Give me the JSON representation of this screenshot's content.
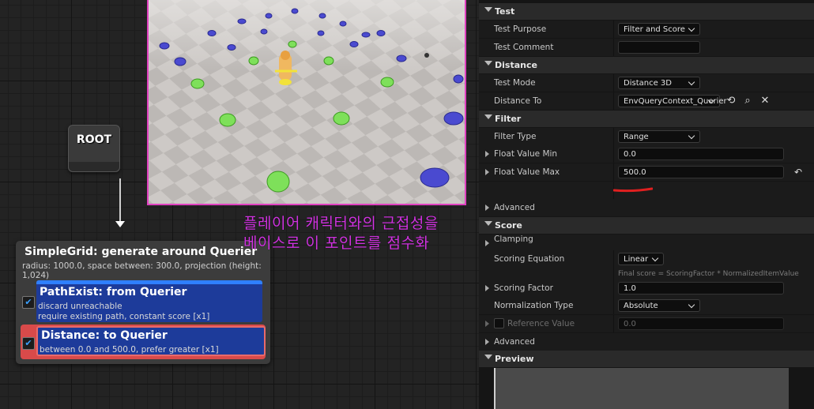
{
  "graph": {
    "root_label": "ROOT",
    "generator": {
      "title": "SimpleGrid: generate around Querier",
      "subtitle": "radius: 1000.0, space between: 300.0, projection (height: 1,024)"
    },
    "tests": [
      {
        "title": "PathExist: from Querier",
        "line1": "discard unreachable",
        "line2": "require existing path, constant score [x1]",
        "checked": true
      },
      {
        "title": "Distance: to Querier",
        "line1": "between 0.0 and 500.0, prefer greater [x1]",
        "checked": true,
        "highlight_color": "#d94a4a"
      }
    ]
  },
  "viewport": {
    "caption_line1": "플레이어 캐릭터와의 근접성을",
    "caption_line2": "베이스로 이 포인트를 점수화",
    "caption_color": "#d033e0",
    "border_color": "#e040c0"
  },
  "details": {
    "sections": {
      "test": "Test",
      "distance": "Distance",
      "filter": "Filter",
      "score": "Score",
      "preview": "Preview"
    },
    "test_purpose": {
      "label": "Test Purpose",
      "value": "Filter and Score"
    },
    "test_comment": {
      "label": "Test Comment",
      "value": ""
    },
    "test_mode": {
      "label": "Test Mode",
      "value": "Distance 3D"
    },
    "distance_to": {
      "label": "Distance To",
      "value": "EnvQueryContext_Querier"
    },
    "filter_type": {
      "label": "Filter Type",
      "value": "Range"
    },
    "float_min": {
      "label": "Float Value Min",
      "value": "0.0"
    },
    "float_max": {
      "label": "Float Value Max",
      "value": "500.0"
    },
    "advanced_label": "Advanced",
    "clamping": {
      "label": "Clamping"
    },
    "scoring_equation": {
      "label": "Scoring Equation",
      "value": "Linear",
      "hint": "Final score = ScoringFactor * NormalizedItemValue"
    },
    "scoring_factor": {
      "label": "Scoring Factor",
      "value": "1.0"
    },
    "normalization_type": {
      "label": "Normalization Type",
      "value": "Absolute"
    },
    "reference_value": {
      "label": "Reference Value",
      "value": "0.0"
    }
  }
}
